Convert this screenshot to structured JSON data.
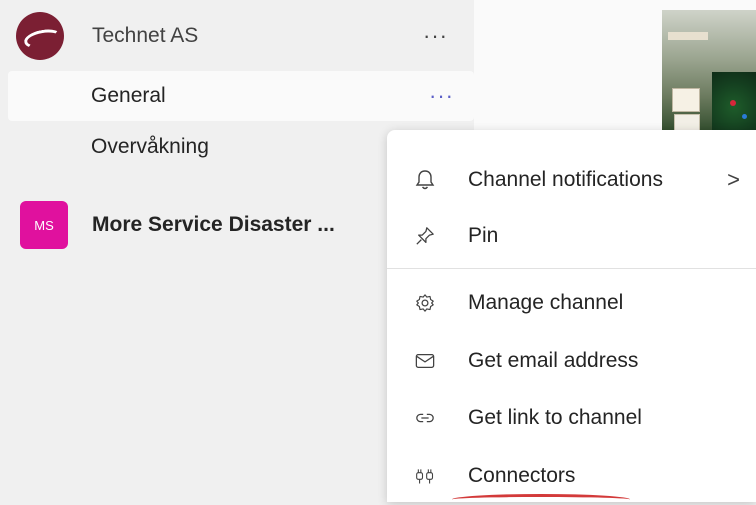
{
  "teams": [
    {
      "name": "Technet AS",
      "more": "···",
      "channels": [
        {
          "label": "General",
          "more": "···"
        },
        {
          "label": "Overvåkning"
        }
      ]
    },
    {
      "avatar_text": "MS",
      "name": "More Service Disaster ..."
    }
  ],
  "context_menu": {
    "items": [
      {
        "label": "Channel notifications",
        "icon": "bell-icon",
        "submenu_indicator": ">"
      },
      {
        "label": "Pin",
        "icon": "pin-icon"
      },
      {
        "label": "Manage channel",
        "icon": "gear-icon"
      },
      {
        "label": "Get email address",
        "icon": "mail-icon"
      },
      {
        "label": "Get link to channel",
        "icon": "link-icon"
      },
      {
        "label": "Connectors",
        "icon": "connectors-icon"
      }
    ]
  },
  "colors": {
    "accent": "#5b5fc7",
    "technet_avatar": "#7b1f33",
    "ms_avatar": "#e0119e"
  }
}
